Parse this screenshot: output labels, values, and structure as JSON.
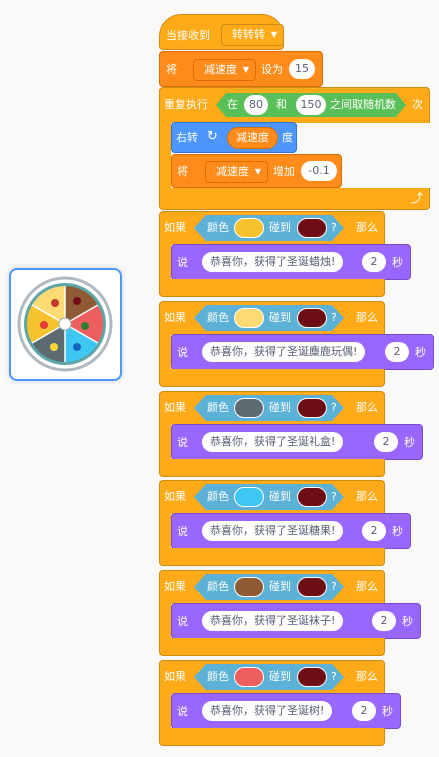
{
  "sprite": {
    "name": "wheel"
  },
  "event_block": {
    "label": "当接收到",
    "message": "转转转"
  },
  "set_block": {
    "label_prefix": "将",
    "variable": "减速度",
    "label_mid": "设为",
    "value": "15"
  },
  "repeat_block": {
    "label": "重复执行",
    "random": {
      "label_in": "在",
      "min": "80",
      "label_and": "和",
      "max": "150",
      "label_rest": "之间取随机数"
    },
    "label_times": "次"
  },
  "turn_block": {
    "label": "右转",
    "reporter": "减速度",
    "label_deg": "度"
  },
  "change_block": {
    "label_prefix": "将",
    "variable": "减速度",
    "label_mid": "增加",
    "value": "-0.1"
  },
  "if_blocks": [
    {
      "label_if": "如果",
      "label_color": "颜色",
      "color1": "#F7C22D",
      "label_touch": "碰到",
      "color2": "#6E0D16",
      "q": "?",
      "label_then": "那么",
      "label_say": "说",
      "message": "恭喜你，获得了圣诞蜡烛!",
      "secs": "2",
      "label_sec": "秒"
    },
    {
      "label_if": "如果",
      "label_color": "颜色",
      "color1": "#FDDB72",
      "label_touch": "碰到",
      "color2": "#6E0D16",
      "q": "?",
      "label_then": "那么",
      "label_say": "说",
      "message": "恭喜你，获得了圣诞麋鹿玩偶!",
      "secs": "2",
      "label_sec": "秒"
    },
    {
      "label_if": "如果",
      "label_color": "颜色",
      "color1": "#5D6A70",
      "label_touch": "碰到",
      "color2": "#6E0D16",
      "q": "?",
      "label_then": "那么",
      "label_say": "说",
      "message": "恭喜你，获得了圣诞礼盒!",
      "secs": "2",
      "label_sec": "秒"
    },
    {
      "label_if": "如果",
      "label_color": "颜色",
      "color1": "#3EC7F2",
      "label_touch": "碰到",
      "color2": "#6E0D16",
      "q": "?",
      "label_then": "那么",
      "label_say": "说",
      "message": "恭喜你，获得了圣诞糖果!",
      "secs": "2",
      "label_sec": "秒"
    },
    {
      "label_if": "如果",
      "label_color": "颜色",
      "color1": "#8E5B35",
      "label_touch": "碰到",
      "color2": "#6E0D16",
      "q": "?",
      "label_then": "那么",
      "label_say": "说",
      "message": "恭喜你，获得了圣诞袜子!",
      "secs": "2",
      "label_sec": "秒"
    },
    {
      "label_if": "如果",
      "label_color": "颜色",
      "color1": "#EE5E5E",
      "label_touch": "碰到",
      "color2": "#6E0D16",
      "q": "?",
      "label_then": "那么",
      "label_say": "说",
      "message": "恭喜你，获得了圣诞树!",
      "secs": "2",
      "label_sec": "秒"
    }
  ]
}
